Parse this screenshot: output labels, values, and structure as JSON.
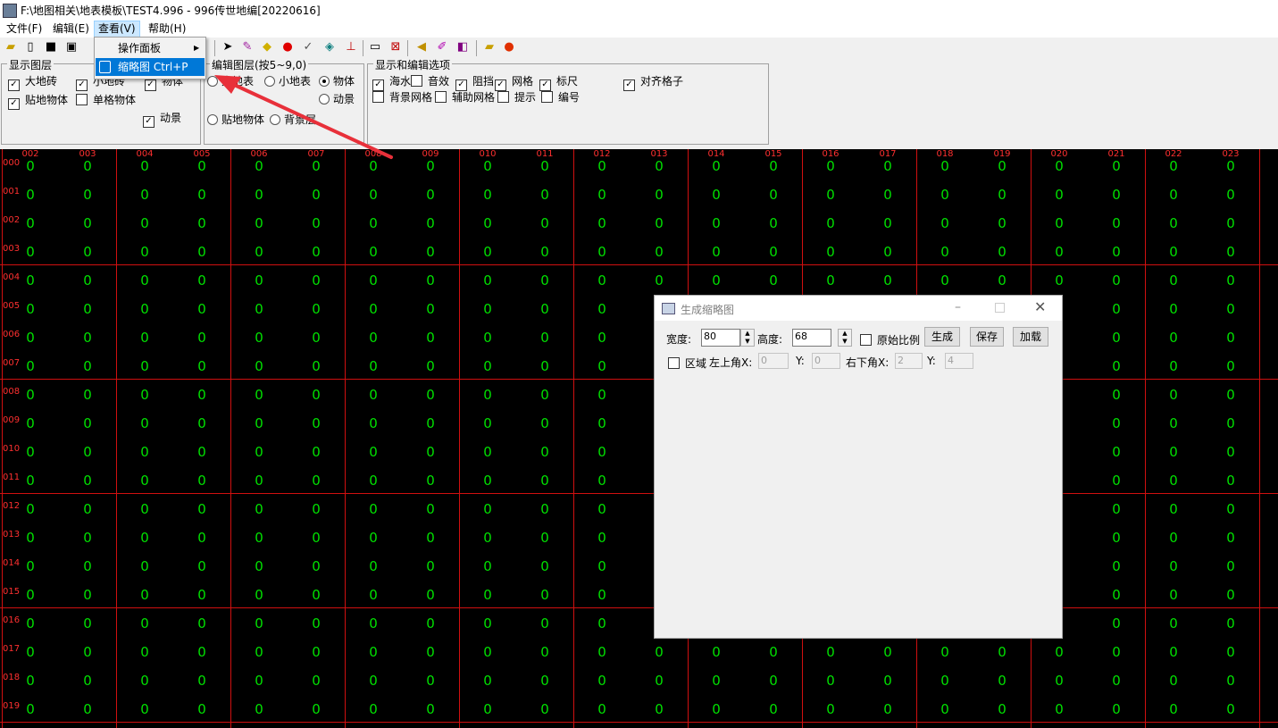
{
  "window": {
    "title": "F:\\地图相关\\地表模板\\TEST4.996 - 996传世地编[20220616]"
  },
  "menu": {
    "items": [
      "文件(F)",
      "编辑(E)",
      "查看(V)",
      "帮助(H)"
    ]
  },
  "dropdown": {
    "items": [
      {
        "label": "操作面板"
      },
      {
        "label": "缩略图 Ctrl+P"
      }
    ]
  },
  "toolbar": {
    "icons": [
      "open-folder-icon",
      "new-file-icon",
      "save-icon",
      "save-all-icon",
      "pointer-icon",
      "pencil-icon",
      "warning-sign-icon",
      "stop-sign-icon",
      "brush-icon",
      "fill-icon",
      "flip-icon",
      "rectangle-icon",
      "delete-region-icon",
      "sound-icon",
      "pen-icon",
      "layers-icon",
      "open-map-icon",
      "tomato-icon"
    ]
  },
  "panel_display_layers": {
    "title": "显示图层",
    "items": [
      {
        "label": "大地砖",
        "checked": true
      },
      {
        "label": "小地砖",
        "checked": true
      },
      {
        "label": "物体",
        "checked": true
      },
      {
        "label": "贴地物体",
        "checked": true
      },
      {
        "label": "单格物体",
        "checked": false
      },
      {
        "label": "动景",
        "checked": true
      }
    ]
  },
  "panel_edit_layers": {
    "title": "编辑图层(按5~9,0)",
    "items": [
      {
        "label": "大地表",
        "selected": false
      },
      {
        "label": "小地表",
        "selected": false
      },
      {
        "label": "物体",
        "selected": true
      },
      {
        "label": "动景",
        "selected": false
      },
      {
        "label": "贴地物体",
        "selected": false
      },
      {
        "label": "背景层",
        "selected": false
      }
    ]
  },
  "panel_options": {
    "title": "显示和编辑选项",
    "items": [
      {
        "label": "海水",
        "checked": true
      },
      {
        "label": "音效",
        "checked": false
      },
      {
        "label": "阻挡",
        "checked": true
      },
      {
        "label": "网格",
        "checked": true
      },
      {
        "label": "标尺",
        "checked": true
      },
      {
        "label": "对齐格子",
        "checked": true
      },
      {
        "label": "背景网格",
        "checked": false
      },
      {
        "label": "辅助网格",
        "checked": false
      },
      {
        "label": "提示",
        "checked": false
      },
      {
        "label": "编号",
        "checked": false
      }
    ]
  },
  "map": {
    "column_labels": [
      "002",
      "003",
      "004",
      "005",
      "006",
      "007",
      "008",
      "009",
      "010",
      "011",
      "012",
      "013",
      "014",
      "015",
      "016",
      "017",
      "018",
      "019",
      "020",
      "021",
      "022",
      "023"
    ],
    "row_labels": [
      "000",
      "001",
      "002",
      "003",
      "004",
      "005",
      "006",
      "007",
      "008",
      "009",
      "010",
      "011",
      "012",
      "013",
      "014",
      "015",
      "016",
      "017",
      "018",
      "019"
    ],
    "cell_value": "0",
    "grid_color": "#d01010",
    "label_color": "#ff3030",
    "value_color": "#00e000"
  },
  "dialog": {
    "title": "生成缩略图",
    "width_label": "宽度:",
    "width_value": "80",
    "height_label": "高度:",
    "height_value": "68",
    "keep_ratio_label": "原始比例",
    "generate_button": "生成",
    "save_button": "保存",
    "load_button": "加载",
    "region_label": "区域",
    "top_left_x_label": "左上角X:",
    "top_left_x_value": "0",
    "top_left_y_label": "Y:",
    "top_left_y_value": "0",
    "bottom_right_x_label": "右下角X:",
    "bottom_right_x_value": "2",
    "bottom_right_y_label": "Y:",
    "bottom_right_y_value": "4"
  },
  "annotation": {
    "arrow_color": "#e8303a"
  }
}
